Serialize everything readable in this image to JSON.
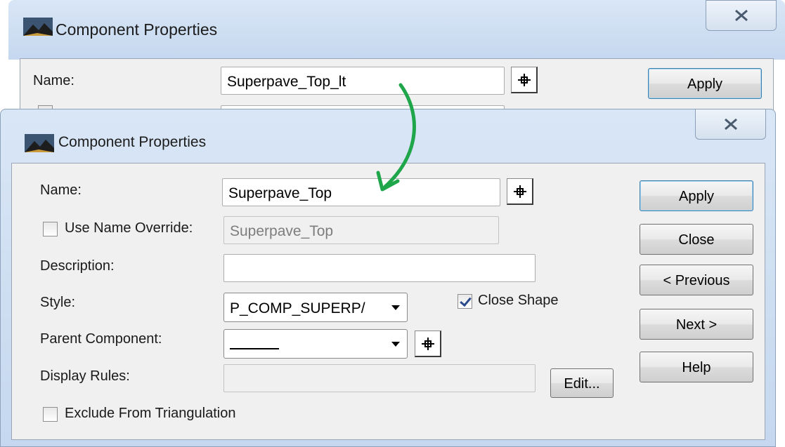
{
  "back_window": {
    "title": "Component Properties",
    "name_label": "Name:",
    "name_value": "Superpave_Top_lt",
    "apply_label": "Apply"
  },
  "front_window": {
    "title": "Component Properties",
    "fields": {
      "name_label": "Name:",
      "name_value": "Superpave_Top",
      "use_name_override_label": "Use Name Override:",
      "use_name_override_checked": false,
      "name_override_value": "Superpave_Top",
      "description_label": "Description:",
      "description_value": "",
      "style_label": "Style:",
      "style_value": "P_COMP_SUPERP/",
      "close_shape_label": "Close Shape",
      "close_shape_checked": true,
      "parent_component_label": "Parent Component:",
      "parent_component_value": "",
      "display_rules_label": "Display Rules:",
      "display_rules_value": "",
      "edit_label": "Edit...",
      "exclude_label": "Exclude From Triangulation",
      "exclude_checked": false
    },
    "buttons": {
      "apply": "Apply",
      "close": "Close",
      "previous": "< Previous",
      "next": "Next >",
      "help": "Help"
    }
  },
  "annotation": {
    "arrow_color": "#1fa64a"
  },
  "icons": [
    "app-icon",
    "close-x-icon",
    "crosshair-pick-icon",
    "dropdown-arrow-icon"
  ]
}
